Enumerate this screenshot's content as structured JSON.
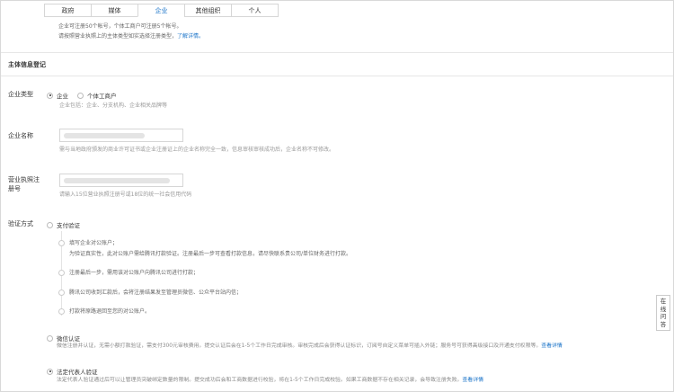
{
  "tabs": [
    {
      "label": "政府",
      "active": false
    },
    {
      "label": "媒体",
      "active": false
    },
    {
      "label": "企业",
      "active": true
    },
    {
      "label": "其他组织",
      "active": false
    },
    {
      "label": "个人",
      "active": false
    }
  ],
  "intro": {
    "line1": "企业可注册50个帐号，个体工商户可注册5个帐号。",
    "line2": "请按照营业执照上的主体类型如实选择注册类型，",
    "link": "了解详情。"
  },
  "section_title": "主体信息登记",
  "company_type": {
    "label": "企业类型",
    "options": [
      "企业",
      "个体工商户"
    ],
    "selected": "企业",
    "hint": "企业包括：企业、分支机构、企业相关品牌等"
  },
  "company_name": {
    "label": "企业名称",
    "hint": "需与当地政府颁发的商业许可证书或企业注册证上的企业名称完全一致，信息审核审核成功后，企业名称不可修改。"
  },
  "license_no": {
    "label_line1": "营业执照注",
    "label_line2": "册号",
    "hint": "请输入15位营业执照注册号或18位的统一社会信用代码"
  },
  "verify": {
    "label": "验证方式",
    "payment": {
      "title": "支付验证",
      "steps": [
        "填写企业对公账户；",
        "为验证真实性，此对公账户需给腾讯打款验证。注册最后一步可查看打款信息，请尽快联系贵公司/单位财务进行打款。",
        "注册最后一步，需用该对公账户向腾讯公司进行打款；",
        "腾讯公司收到汇款后，会将注册结果发至管理员微信、公众平台站内信；",
        "打款将原路退回至您的对公账户。"
      ]
    },
    "wechat": {
      "title": "微信认证",
      "desc": "微信注册并认证，无需小额打款验证，需支付300元审核费用。提交认证后会在1-5个工作日完成审核。审核完成后会获得认证标识，订阅号自定义菜单可插入外链；服务号可获得高级接口及开通支付权限等。",
      "link": "查看详情"
    },
    "legal": {
      "title": "法定代表人验证",
      "desc": "法定代表人验证通过后可以让管理员突破绑定数量的限制。提交成功后会和工商数据进行校验，将在1-5个工作日完成校验。如果工商数据不存在相关记录，会导致注册失败。",
      "link": "查看详情"
    },
    "selected": "legal"
  },
  "help_widget": [
    "在",
    "线",
    "问",
    "答"
  ]
}
